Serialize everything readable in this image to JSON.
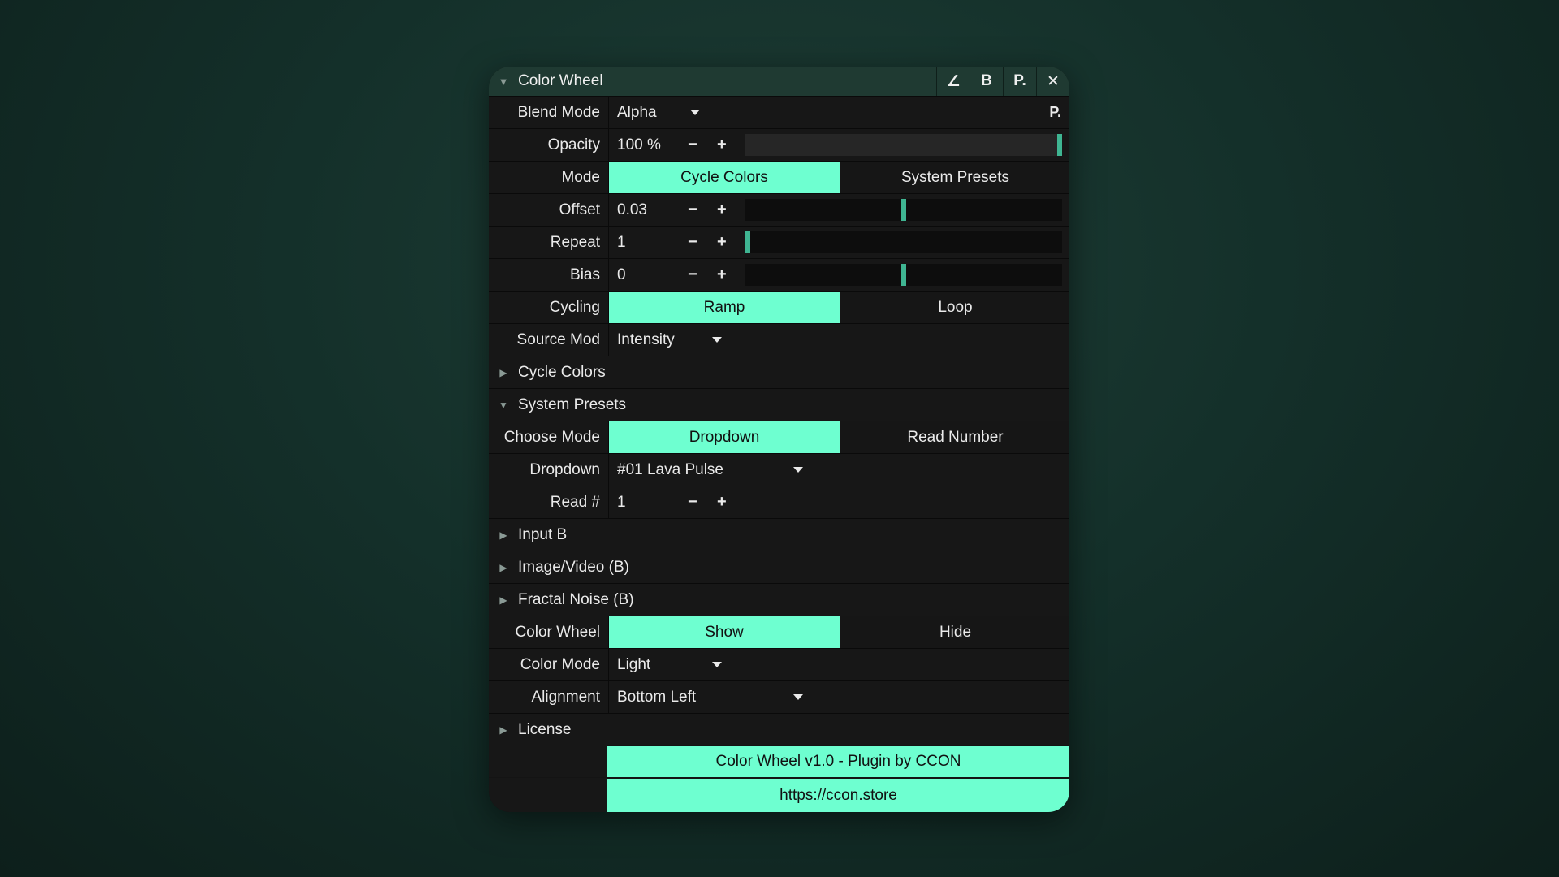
{
  "window": {
    "title": "Color Wheel",
    "collapse_glyph": "▼",
    "buttons": [
      {
        "label": "∠",
        "icon": "angle-icon"
      },
      {
        "label": "B",
        "icon": "bypass-icon"
      },
      {
        "label": "P.",
        "icon": "preset-icon"
      },
      {
        "label": "✕",
        "icon": "close-icon"
      }
    ]
  },
  "colors": {
    "accent": "#6effd0",
    "slider": "#3fb592",
    "titlebar": "#1f3a32",
    "background": "#141414"
  },
  "blend_mode": {
    "label": "Blend Mode",
    "value": "Alpha",
    "preset_btn": "P."
  },
  "opacity": {
    "label": "Opacity",
    "value": "100 %",
    "minus": "−",
    "plus": "+",
    "fraction": 1.0
  },
  "mode": {
    "label": "Mode",
    "options": [
      "Cycle Colors",
      "System Presets"
    ],
    "selected": 0
  },
  "offset": {
    "label": "Offset",
    "value": "0.03",
    "minus": "−",
    "plus": "+",
    "fraction": 0.5
  },
  "repeat": {
    "label": "Repeat",
    "value": "1",
    "minus": "−",
    "plus": "+",
    "fraction": 0.0
  },
  "bias": {
    "label": "Bias",
    "value": "0",
    "minus": "−",
    "plus": "+",
    "fraction": 0.5
  },
  "cycling": {
    "label": "Cycling",
    "options": [
      "Ramp",
      "Loop"
    ],
    "selected": 0
  },
  "source_mod": {
    "label": "Source Mod",
    "value": "Intensity"
  },
  "sections": {
    "cycle_colors": {
      "name": "Cycle Colors",
      "arrow": "▶"
    },
    "system_presets": {
      "name": "System Presets",
      "arrow": "▼"
    },
    "input_b": {
      "name": "Input B",
      "arrow": "▶"
    },
    "image_video": {
      "name": "Image/Video (B)",
      "arrow": "▶"
    },
    "fractal_noise": {
      "name": "Fractal Noise (B)",
      "arrow": "▶"
    },
    "license": {
      "name": "License",
      "arrow": "▶"
    }
  },
  "choose_mode": {
    "label": "Choose Mode",
    "options": [
      "Dropdown",
      "Read Number"
    ],
    "selected": 0
  },
  "dropdown": {
    "label": "Dropdown",
    "value": "#01 Lava Pulse"
  },
  "read_num": {
    "label": "Read #",
    "value": "1",
    "minus": "−",
    "plus": "+"
  },
  "color_wheel": {
    "label": "Color Wheel",
    "options": [
      "Show",
      "Hide"
    ],
    "selected": 0
  },
  "color_mode": {
    "label": "Color Mode",
    "value": "Light"
  },
  "alignment": {
    "label": "Alignment",
    "value": "Bottom Left"
  },
  "footer": {
    "credit": "Color Wheel v1.0 - Plugin by CCON",
    "url": "https://ccon.store"
  }
}
